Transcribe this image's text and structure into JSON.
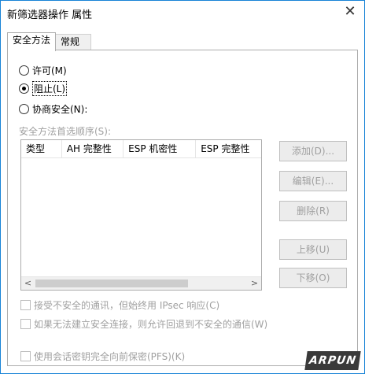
{
  "window": {
    "title": "新筛选器操作 属性",
    "close_glyph": "✕"
  },
  "tabs": [
    {
      "label": "安全方法",
      "active": true
    },
    {
      "label": "常规",
      "active": false
    }
  ],
  "radios": {
    "permit": {
      "label": "许可(M)",
      "checked": false
    },
    "block": {
      "label": "阻止(L)",
      "checked": true
    },
    "negotiate": {
      "label": "协商安全(N):",
      "checked": false
    }
  },
  "methods": {
    "order_label": "安全方法首选顺序(S):",
    "columns": [
      "类型",
      "AH 完整性",
      "ESP 机密性",
      "ESP 完整性"
    ],
    "rows": []
  },
  "buttons": {
    "add": "添加(D)...",
    "edit": "编辑(E)...",
    "remove": "删除(R)",
    "move_up": "上移(U)",
    "move_down": "下移(O)"
  },
  "checkboxes": {
    "accept_unsecured": {
      "label": "接受不安全的通讯，但始终用 IPsec 响应(C)",
      "checked": false
    },
    "allow_fallback": {
      "label": "如果无法建立安全连接，则允许回退到不安全的通信(W)",
      "checked": false
    },
    "pfs": {
      "label": "使用会话密钥完全向前保密(PFS)(K)",
      "checked": false
    }
  },
  "watermark": "ARPUN"
}
